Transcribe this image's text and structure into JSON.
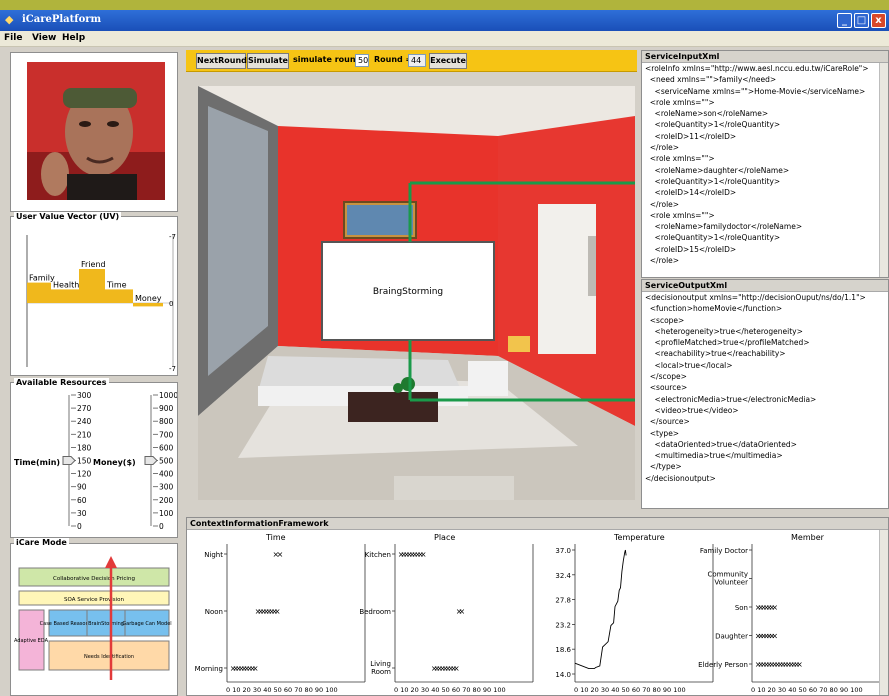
{
  "window": {
    "title": "iCarePlatform"
  },
  "menu": [
    "File",
    "View",
    "Help"
  ],
  "toolbar": {
    "next_round": "NextRound",
    "simulate": "Simulate",
    "simulate_round_label": "simulate round",
    "simulate_round_value": "50",
    "round_label": "Round =",
    "round_value": "44",
    "execute": "Execute"
  },
  "uv": {
    "title": "User Value Vector (UV)",
    "bars": [
      {
        "label": "Family",
        "value": 0.3
      },
      {
        "label": "Health",
        "value": 0.2
      },
      {
        "label": "Friend",
        "value": 0.5
      },
      {
        "label": "Time",
        "value": 0.2
      },
      {
        "label": "Money",
        "value": -0.05
      }
    ],
    "ticks": [
      "-7",
      "0",
      "-7"
    ]
  },
  "resources": {
    "title": "Available Resources",
    "time_label": "Time(min)",
    "money_label": "Money($)",
    "time_ticks": [
      "300",
      "270",
      "240",
      "210",
      "180",
      "150",
      "120",
      "90",
      "60",
      "30",
      "0"
    ],
    "money_ticks": [
      "1000",
      "900",
      "800",
      "700",
      "600",
      "500",
      "400",
      "300",
      "200",
      "100",
      "0"
    ],
    "time_value": 150,
    "money_value": 500
  },
  "mode": {
    "title": "iCare Mode",
    "layers": [
      "Collaborative Decision Pricing",
      "SOA Service Provision",
      "Case Based Reasoning",
      "BrainStorming",
      "Garbage Can Model",
      "Adaptive EDA",
      "Needs Identification"
    ]
  },
  "scene": {
    "overlay_label": "BraingStorming"
  },
  "service_input": {
    "title": "ServiceInputXml",
    "lines": [
      "<roleInfo xmlns=\"http://www.aesl.nccu.edu.tw/iCareRole\">",
      "  <need xmlns=\"\">family</need>",
      "    <serviceName xmlns=\"\">Home-Movie</serviceName>",
      "  <role xmlns=\"\">",
      "    <roleName>son</roleName>",
      "    <roleQuantity>1</roleQuantity>",
      "    <roleID>11</roleID>",
      "  </role>",
      "  <role xmlns=\"\">",
      "    <roleName>daughter</roleName>",
      "    <roleQuantity>1</roleQuantity>",
      "    <roleID>14</roleID>",
      "  </role>",
      "  <role xmlns=\"\">",
      "    <roleName>familydoctor</roleName>",
      "    <roleQuantity>1</roleQuantity>",
      "    <roleID>15</roleID>",
      "  </role>"
    ]
  },
  "service_output": {
    "title": "ServiceOutputXml",
    "lines": [
      "<decisionoutput xmlns=\"http://decisionOuput/ns/do/1.1\">",
      "  <function>homeMovie</function>",
      "  <scope>",
      "    <heterogeneity>true</heterogeneity>",
      "    <profileMatched>true</profileMatched>",
      "    <reachability>true</reachability>",
      "    <local>true</local>",
      "  </scope>",
      "  <source>",
      "    <electronicMedia>true</electronicMedia>",
      "    <video>true</video>",
      "  </source>",
      "  <type>",
      "    <dataOriented>true</dataOriented>",
      "    <multimedia>true</multimedia>",
      "  </type>",
      "</decisionoutput>"
    ]
  },
  "context": {
    "title": "ContextInformationFramework",
    "x_ticks": "0 10 20 30 40 50 60 70 80 90 100"
  },
  "chart_data": [
    {
      "type": "scatter",
      "title": "Time",
      "categories": [
        "Night",
        "Noon",
        "Morning"
      ],
      "points": [
        {
          "category": "Night",
          "x": [
            33,
            36
          ]
        },
        {
          "category": "Noon",
          "x": [
            20,
            22,
            24,
            26,
            28,
            30,
            32,
            34
          ]
        },
        {
          "category": "Morning",
          "x": [
            2,
            4,
            6,
            8,
            10,
            12,
            14,
            16,
            18
          ]
        }
      ],
      "xlim": [
        0,
        100
      ]
    },
    {
      "type": "scatter",
      "title": "Place",
      "categories": [
        "Kitchen",
        "Bedroom",
        "Living Room"
      ],
      "points": [
        {
          "category": "Kitchen",
          "x": [
            2,
            4,
            6,
            8,
            10,
            12,
            14,
            16,
            18
          ]
        },
        {
          "category": "Bedroom",
          "x": [
            44,
            46
          ]
        },
        {
          "category": "Living Room",
          "x": [
            26,
            28,
            30,
            32,
            34,
            36,
            38,
            40,
            42
          ]
        }
      ],
      "xlim": [
        0,
        100
      ]
    },
    {
      "type": "line",
      "title": "Temperature",
      "y_ticks": [
        "37.0",
        "32.4",
        "27.8",
        "23.2",
        "18.6",
        "14.0"
      ],
      "x": [
        0,
        10,
        14,
        15,
        18,
        20,
        22,
        24,
        26,
        28,
        29,
        30,
        31,
        32,
        33,
        34,
        35,
        36,
        36.5,
        37
      ],
      "y": [
        16,
        15,
        15,
        15.2,
        15.5,
        19,
        19.5,
        20,
        23,
        23.5,
        26.5,
        27,
        27.5,
        29.5,
        30,
        33,
        35,
        36.5,
        37,
        36
      ],
      "ylim": [
        14,
        37
      ],
      "xlim": [
        0,
        100
      ]
    },
    {
      "type": "scatter",
      "title": "Member",
      "categories": [
        "Family Doctor",
        "Community Volunteer",
        "Son",
        "Daughter",
        "Elderly Person"
      ],
      "points": [
        {
          "category": "Family Doctor",
          "x": []
        },
        {
          "category": "Community Volunteer",
          "x": []
        },
        {
          "category": "Son",
          "x": [
            2,
            4,
            6,
            8,
            10,
            12,
            14
          ]
        },
        {
          "category": "Daughter",
          "x": [
            2,
            4,
            6,
            8,
            10,
            12,
            14
          ]
        },
        {
          "category": "Elderly Person",
          "x": [
            2,
            4,
            6,
            8,
            10,
            12,
            14,
            16,
            18,
            20,
            22,
            24,
            26,
            28,
            30,
            32
          ]
        }
      ],
      "xlim": [
        0,
        100
      ]
    }
  ]
}
